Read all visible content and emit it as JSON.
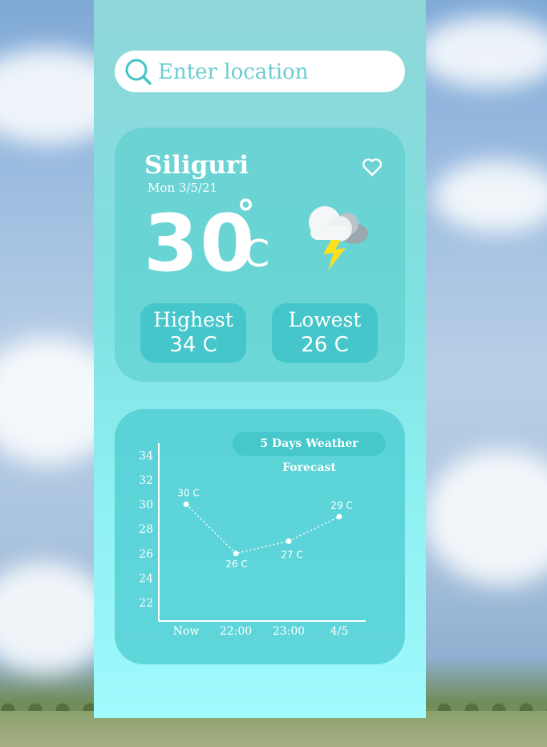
{
  "search": {
    "placeholder": "Enter location",
    "value": ""
  },
  "weather": {
    "city": "Siliguri",
    "date": "Mon 3/5/21",
    "temperature": "30",
    "degree_symbol": "°",
    "unit": "C",
    "condition_icon": "thunderstorm-icon",
    "favorite_icon": "heart-icon",
    "highest_label": "Highest",
    "highest_value": "34 C",
    "lowest_label": "Lowest",
    "lowest_value": "26 C"
  },
  "forecast": {
    "title": "5 Days Weather Forecast"
  },
  "chart_data": {
    "type": "line",
    "title": "5 Days Weather Forecast",
    "categories": [
      "Now",
      "22:00",
      "23:00",
      "4/5"
    ],
    "values": [
      30,
      26,
      27,
      29
    ],
    "point_labels": [
      "30 C",
      "26 C",
      "27 C",
      "29 C"
    ],
    "yticks": [
      22,
      24,
      26,
      28,
      30,
      32,
      34
    ],
    "ylim": [
      20.5,
      35
    ],
    "grid": false,
    "xlabel": "",
    "ylabel": ""
  },
  "colors": {
    "accent": "#46c8cb",
    "panel": "#8fe6e8",
    "text": "#ffffff",
    "bolt": "#ffe01a"
  }
}
